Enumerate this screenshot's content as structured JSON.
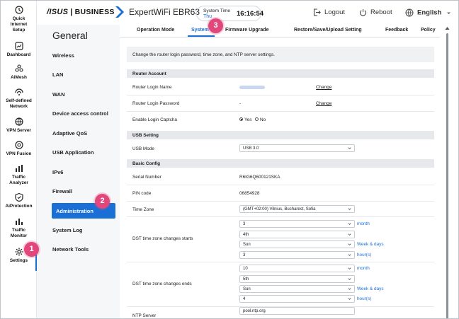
{
  "colors": {
    "accent": "#1a6fd6",
    "badge": "#e1477a"
  },
  "leftnav": [
    {
      "label": "Quick\nInternet\nSetup",
      "icon": "quick-setup-icon"
    },
    {
      "label": "Dashboard",
      "icon": "dashboard-icon"
    },
    {
      "label": "AiMesh",
      "icon": "aimesh-icon"
    },
    {
      "label": "Self-defined\nNetwork",
      "icon": "network-icon"
    },
    {
      "label": "VPN Server",
      "icon": "vpn-server-icon"
    },
    {
      "label": "VPN Fusion",
      "icon": "vpn-fusion-icon"
    },
    {
      "label": "Traffic\nAnalyzer",
      "icon": "traffic-analyzer-icon"
    },
    {
      "label": "AiProtection",
      "icon": "shield-icon"
    },
    {
      "label": "Traffic\nMonitor",
      "icon": "traffic-monitor-icon"
    },
    {
      "label": "Settings",
      "icon": "gear-icon"
    }
  ],
  "header": {
    "brand": "/ISUS",
    "brand_sep": "|",
    "brand_biz": "BUSINESS",
    "model": "ExpertWiFi EBR63",
    "system_time_label": "System Time",
    "system_time_day": "Thu",
    "system_time_clock": "16:16:54",
    "logout": "Logout",
    "reboot": "Reboot",
    "language": "English"
  },
  "sidemenu": {
    "title": "General",
    "items": [
      "Wireless",
      "LAN",
      "WAN",
      "Device access control",
      "Adaptive QoS",
      "USB Application",
      "IPv6",
      "Firewall",
      "Administration",
      "System Log",
      "Network Tools"
    ]
  },
  "tabs": [
    "Operation Mode",
    "System",
    "Firmware Upgrade",
    "Restore/Save/Upload Setting",
    "Feedback",
    "Policy"
  ],
  "main": {
    "description": "Change the router login password, time zone, and NTP server settings.",
    "router_account": {
      "title": "Router Account",
      "login_name_label": "Router Login Name",
      "login_password_label": "Router Login Password",
      "login_password_value": "-",
      "change": "Change",
      "captcha_label": "Enable Login Captcha",
      "yes": "Yes",
      "no": "No"
    },
    "usb_setting": {
      "title": "USB Setting",
      "mode_label": "USB Mode",
      "mode_value": "USB 3.0"
    },
    "basic_config": {
      "title": "Basic Config",
      "serial_label": "Serial Number",
      "serial_value": "R6IG6Q600121SKA",
      "pin_label": "PIN code",
      "pin_value": "06854928",
      "timezone_label": "Time Zone",
      "timezone_value": "(GMT+02:00) Vilnius, Bucharest, Sofia",
      "dst_start_label": "DST time zone changes starts",
      "dst_start": [
        "3",
        "4th",
        "Sun",
        "3"
      ],
      "dst_end_label": "DST time zone changes ends",
      "dst_end": [
        "10",
        "5th",
        "Sun",
        "4"
      ],
      "unit_month": "month",
      "unit_week": "Week & days",
      "unit_hour": "hour(s)",
      "ntp_label": "NTP Server",
      "ntp_value": "pool.ntp.org"
    }
  },
  "badges": [
    "1",
    "2",
    "3"
  ]
}
